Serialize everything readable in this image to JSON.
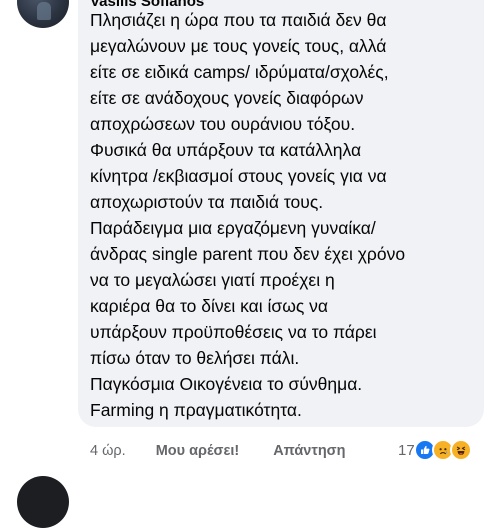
{
  "comment": {
    "author": "Vasilis Sofianos",
    "lines": [
      "Πλησιάζει η ώρα που τα παιδιά δεν θα",
      "μεγαλώνουν με τους γονείς τους, αλλά",
      "είτε σε ειδικά camps/ ιδρύματα/σχολές,",
      "είτε σε ανάδοχους γονείς διαφόρων",
      "αποχρώσεων του ουράνιου τόξου.",
      "Φυσικά θα υπάρξουν τα κατάλληλα",
      "κίνητρα /εκβιασμοί στους γονείς για να",
      "αποχωριστούν τα παιδιά τους.",
      "Παράδειγμα μια εργαζόμενη γυναίκα/",
      "άνδρας single parent που δεν έχει χρόνο",
      "να το μεγαλώσει γιατί προέχει η",
      "καριέρα θα το δίνει και ίσως να",
      "υπάρξουν προϋποθέσεις να το πάρει",
      "πίσω όταν το θελήσει πάλι.",
      "Παγκόσμια Οικογένεια το σύνθημα.",
      "Farming η πραγματικότητα."
    ]
  },
  "actions": {
    "time": "4 ώρ.",
    "like_label": "Μου αρέσει!",
    "reply_label": "Απάντηση"
  },
  "reactions": {
    "count": "17",
    "icons": [
      "like-icon",
      "sad-icon",
      "haha-icon"
    ],
    "colors": {
      "like": "#1877f2",
      "sad": "#f7b125",
      "haha": "#f7b125"
    }
  }
}
